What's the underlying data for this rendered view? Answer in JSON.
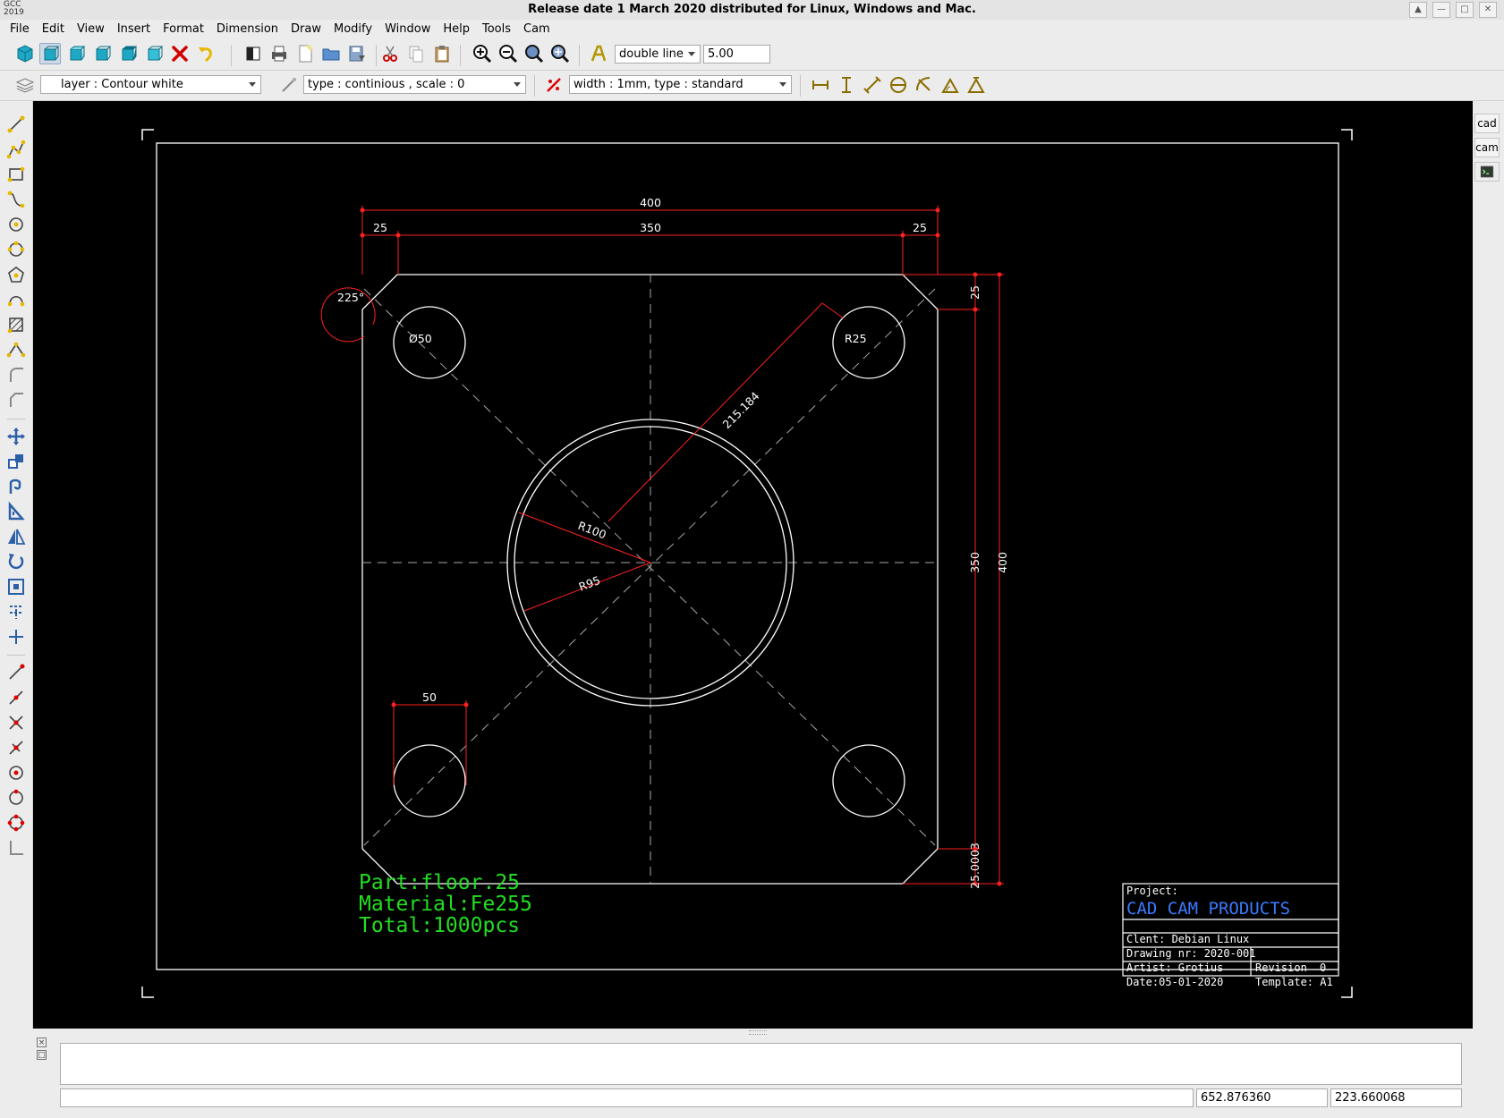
{
  "app": {
    "logo_top": "GCC",
    "logo_bottom": "2019",
    "title": "Release date 1 March 2020 distributed for Linux, Windows and Mac."
  },
  "menu": [
    "File",
    "Edit",
    "View",
    "Insert",
    "Format",
    "Dimension",
    "Draw",
    "Modify",
    "Window",
    "Help",
    "Tools",
    "Cam"
  ],
  "toolbar": {
    "linetype_value": "double line",
    "line_offset_value": "5.00",
    "layer_value": "layer : Contour white",
    "type_value": "type : continious , scale : 0",
    "width_value": "width : 1mm, type : standard"
  },
  "side_tabs": [
    "cad",
    "cam"
  ],
  "drawing": {
    "dim_overall_width": "400",
    "dim_inner_width": "350",
    "dim_left_offset": "25",
    "dim_right_offset": "25",
    "dim_angle": "225°",
    "dim_hole_dia": "Ø50",
    "dim_hole_radius": "R25",
    "dim_diagonal": "215.184",
    "dim_big_r1": "R100",
    "dim_big_r2": "R95",
    "dim_hole_width": "50",
    "dim_right_top": "25",
    "dim_right_inner": "350",
    "dim_right_overall": "400",
    "dim_right_bottom": "25.0003",
    "part_line1": "Part:floor.25",
    "part_line2": "Material:Fe255",
    "part_line3": "Total:1000pcs"
  },
  "titleblock": {
    "project_label": "Project:",
    "project_name": "CAD CAM PRODUCTS",
    "client": "Clent: Debian Linux",
    "drawing_nr": "Drawing nr: 2020-001",
    "artist": "Artist: Grotius",
    "revision_label": "Revision",
    "revision_value": "0",
    "date": "Date:05-01-2020",
    "template": "Template: A1"
  },
  "status": {
    "x": "652.876360",
    "y": "223.660068"
  },
  "colors": {
    "dimension": "#ff2020",
    "part_text": "#22dd22",
    "project_name": "#3a7aff",
    "geometry": "#ffffff"
  }
}
